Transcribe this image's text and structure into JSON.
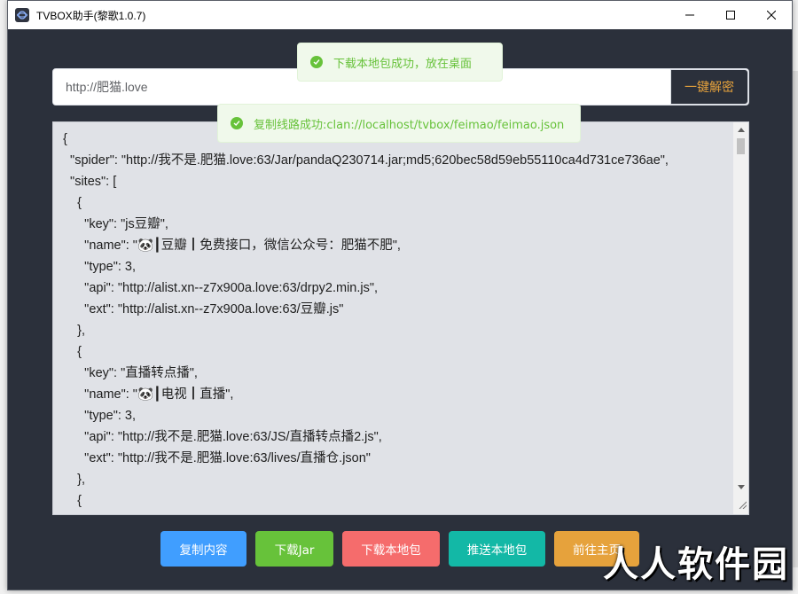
{
  "window": {
    "title": "TVBOX助手(黎歌1.0.7)"
  },
  "url_bar": {
    "value": "http://肥猫.love",
    "decrypt_label": "一键解密"
  },
  "toasts": [
    {
      "text": "下载本地包成功，放在桌面"
    },
    {
      "text": "复制线路成功:clan://localhost/tvbox/feimao/feimao.json"
    }
  ],
  "editor": {
    "lines": [
      "{",
      "  \"spider\": \"http://我不是.肥猫.love:63/Jar/pandaQ230714.jar;md5;620bec58d59eb55110ca4d731ce736ae\",",
      "  \"sites\": [",
      "    {",
      "      \"key\": \"js豆瓣\",",
      "      \"name\": \"🐼┃豆瓣┃免费接口，微信公众号：肥猫不肥\",",
      "      \"type\": 3,",
      "      \"api\": \"http://alist.xn--z7x900a.love:63/drpy2.min.js\",",
      "      \"ext\": \"http://alist.xn--z7x900a.love:63/豆瓣.js\"",
      "    },",
      "    {",
      "      \"key\": \"直播转点播\",",
      "      \"name\": \"🐼┃电视┃直播\",",
      "      \"type\": 3,",
      "      \"api\": \"http://我不是.肥猫.love:63/JS/直播转点播2.js\",",
      "      \"ext\": \"http://我不是.肥猫.love:63/lives/直播仓.json\"",
      "    },",
      "    {"
    ]
  },
  "buttons": {
    "copy": "复制内容",
    "download_jar": "下载Jar",
    "download_local": "下载本地包",
    "push_local": "推送本地包",
    "homepage": "前往主页"
  },
  "watermark": "人人软件园",
  "colors": {
    "primary": "#409eff",
    "success": "#67c23a",
    "danger": "#f56c6c",
    "teal": "#13b8a6",
    "warning": "#e6a23c",
    "background": "#2b303b"
  }
}
